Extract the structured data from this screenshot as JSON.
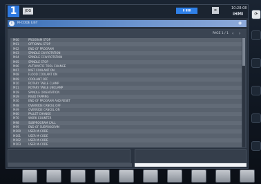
{
  "topbar": {
    "mode_number": "1",
    "mode_label": "JOG",
    "status_pill": "▮ ▮▮▮",
    "small_box": "≡",
    "clock": "10:28:08",
    "brand": "iHMI"
  },
  "title_bar": {
    "title": "M-CODE LIST"
  },
  "panel": {
    "page_label": "PAGE",
    "page_value": "1 / 1"
  },
  "list": {
    "rows": [
      {
        "code": "M00",
        "desc": "PROGRAM STOP"
      },
      {
        "code": "M01",
        "desc": "OPTIONAL STOP"
      },
      {
        "code": "M02",
        "desc": "END OF PROGRAM"
      },
      {
        "code": "M03",
        "desc": "SPINDLE CW ROTATION"
      },
      {
        "code": "M04",
        "desc": "SPINDLE CCW ROTATION"
      },
      {
        "code": "M05",
        "desc": "SPINDLE STOP"
      },
      {
        "code": "M06",
        "desc": "AUTOMATIC TOOL CHANGE"
      },
      {
        "code": "M07",
        "desc": "MIST COOLANT ON"
      },
      {
        "code": "M08",
        "desc": "FLOOD COOLANT ON"
      },
      {
        "code": "M09",
        "desc": "COOLANT OFF"
      },
      {
        "code": "M10",
        "desc": "ROTARY TABLE CLAMP"
      },
      {
        "code": "M11",
        "desc": "ROTARY TABLE UNCLAMP"
      },
      {
        "code": "M19",
        "desc": "SPINDLE ORIENTATION"
      },
      {
        "code": "M29",
        "desc": "RIGID TAPPING"
      },
      {
        "code": "M30",
        "desc": "END OF PROGRAM AND RESET"
      },
      {
        "code": "M48",
        "desc": "OVERRIDE CANCEL OFF"
      },
      {
        "code": "M49",
        "desc": "OVERRIDE CANCEL ON"
      },
      {
        "code": "M60",
        "desc": "PALLET CHANGE"
      },
      {
        "code": "M70",
        "desc": "WORK COUNTER"
      },
      {
        "code": "M98",
        "desc": "SUBPROGRAM CALL"
      },
      {
        "code": "M99",
        "desc": "END OF SUBPROGRAM"
      },
      {
        "code": "M100",
        "desc": "USER M-CODE"
      },
      {
        "code": "M101",
        "desc": "USER M-CODE"
      },
      {
        "code": "M102",
        "desc": "USER M-CODE"
      },
      {
        "code": "M103",
        "desc": "USER M-CODE"
      }
    ]
  },
  "softkeys": [
    "",
    "",
    "",
    "",
    "",
    "",
    "",
    "",
    "",
    ""
  ],
  "colors": {
    "accent": "#2f7ae0",
    "title_bar": "#3a6fb6",
    "list_bg": "#59626e"
  }
}
